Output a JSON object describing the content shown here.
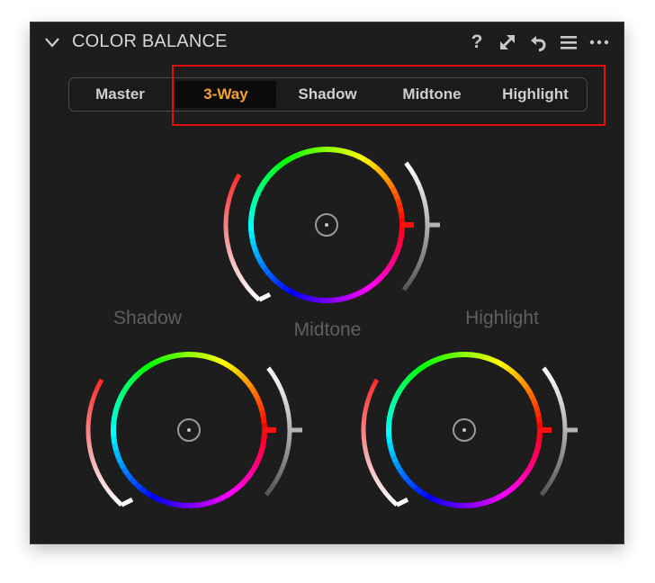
{
  "panel": {
    "title": "COLOR BALANCE",
    "header_icons": [
      "help-icon",
      "expand-icon",
      "reset-icon",
      "menu-icon",
      "more-icon"
    ],
    "help_glyph": "?"
  },
  "tabs": {
    "items": [
      {
        "label": "Master",
        "active": false
      },
      {
        "label": "3-Way",
        "active": true
      },
      {
        "label": "Shadow",
        "active": false
      },
      {
        "label": "Midtone",
        "active": false
      },
      {
        "label": "Highlight",
        "active": false
      }
    ]
  },
  "wheels": {
    "shadow_label": "Shadow",
    "midtone_label": "Midtone",
    "highlight_label": "Highlight"
  },
  "colors": {
    "accent": "#f2a132",
    "annotation": "#e01010",
    "panel_bg": "#1d1d1d",
    "label": "#5f5f5f"
  }
}
